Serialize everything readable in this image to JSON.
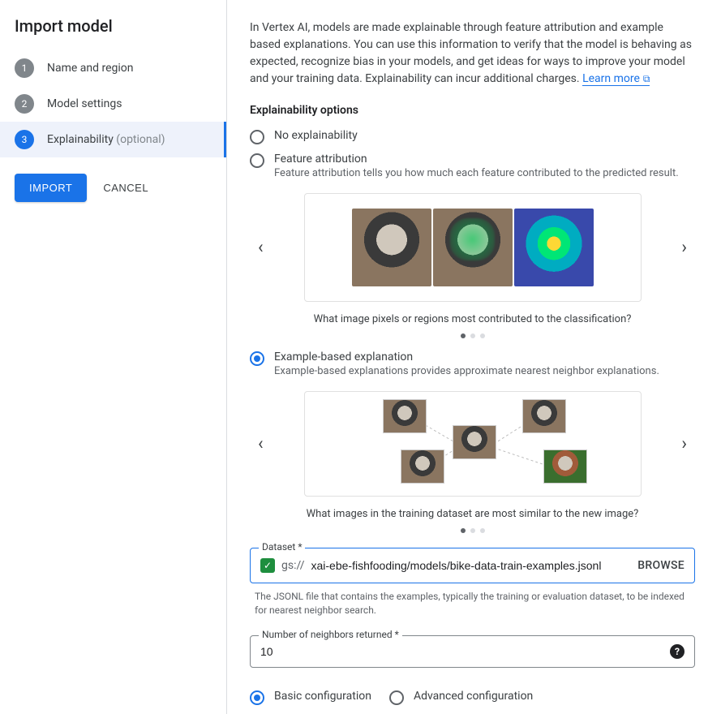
{
  "sidebar": {
    "title": "Import model",
    "steps": [
      {
        "num": "1",
        "label": "Name and region"
      },
      {
        "num": "2",
        "label": "Model settings"
      },
      {
        "num": "3",
        "label": "Explainability",
        "optional": "(optional)"
      }
    ],
    "importBtn": "IMPORT",
    "cancelBtn": "CANCEL"
  },
  "main": {
    "intro": "In Vertex AI, models are made explainable through feature attribution and example based explanations. You can use this information to verify that the model is behaving as expected, recognize bias in your models, and get ideas for ways to improve your model and your training data. Explainability can incur additional charges. ",
    "learnMore": "Learn more",
    "sectionTitle": "Explainability options",
    "optNone": "No explainability",
    "optFeature": "Feature attribution",
    "optFeatureDesc": "Feature attribution tells you how much each feature contributed to the predicted result.",
    "featureCaption": "What image pixels or regions most contributed to the classification?",
    "optExample": "Example-based explanation",
    "optExampleDesc": "Example-based explanations provides approximate nearest neighbor explanations.",
    "exampleCaption": "What images in the training dataset are most similar to the new image?",
    "datasetLabel": "Dataset *",
    "gsPrefix": "gs://",
    "datasetValue": "xai-ebe-fishfooding/models/bike-data-train-examples.jsonl",
    "browse": "BROWSE",
    "datasetHelper": "The JSONL file that contains the examples, typically the training or evaluation dataset, to be indexed for nearest neighbor search.",
    "neighborsLabel": "Number of neighbors returned *",
    "neighborsValue": "10",
    "basicConfig": "Basic configuration",
    "advConfig": "Advanced configuration"
  }
}
